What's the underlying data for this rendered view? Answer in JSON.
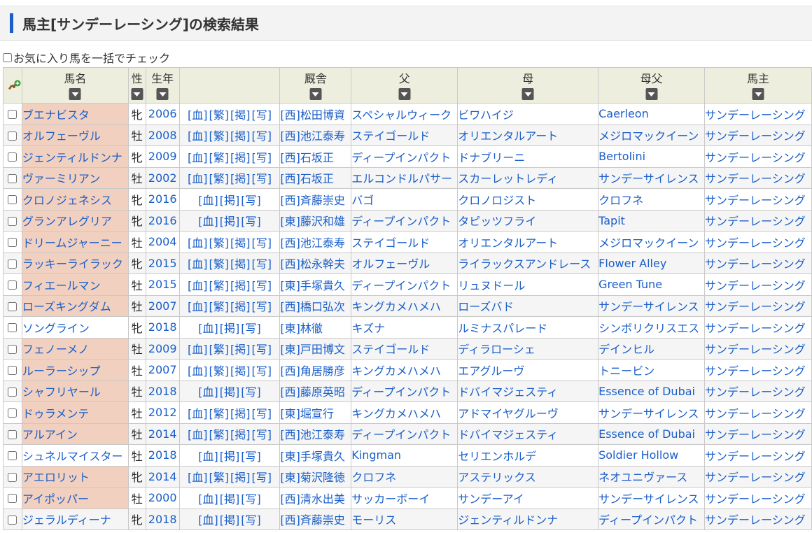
{
  "page": {
    "title": "馬主[サンデーレーシング]の検索結果"
  },
  "fav_check_all": {
    "label": "お気に入り馬を一括でチェック"
  },
  "table": {
    "headers": {
      "name": "馬名",
      "sex": "性",
      "year": "生年",
      "links": "",
      "trainer": "厩舎",
      "sire": "父",
      "dam": "母",
      "damsire": "母父",
      "owner": "馬主"
    },
    "rows": [
      {
        "name": "ブエナビスタ",
        "hl": true,
        "sex": "牝",
        "year": "2006",
        "links": [
          "[血]",
          "[繁]",
          "[掲]",
          "[写]"
        ],
        "trainer": "[西]松田博資",
        "sire": "スペシャルウィーク",
        "dam": "ビワハイジ",
        "damsire": "Caerleon",
        "owner": "サンデーレーシング"
      },
      {
        "name": "オルフェーヴル",
        "hl": true,
        "sex": "牡",
        "year": "2008",
        "links": [
          "[血]",
          "[繁]",
          "[掲]",
          "[写]"
        ],
        "trainer": "[西]池江泰寿",
        "sire": "ステイゴールド",
        "dam": "オリエンタルアート",
        "damsire": "メジロマックイーン",
        "owner": "サンデーレーシング"
      },
      {
        "name": "ジェンティルドンナ",
        "hl": true,
        "sex": "牝",
        "year": "2009",
        "links": [
          "[血]",
          "[繁]",
          "[掲]",
          "[写]"
        ],
        "trainer": "[西]石坂正",
        "sire": "ディープインパクト",
        "dam": "ドナブリーニ",
        "damsire": "Bertolini",
        "owner": "サンデーレーシング"
      },
      {
        "name": "ヴァーミリアン",
        "hl": true,
        "sex": "牡",
        "year": "2002",
        "links": [
          "[血]",
          "[繁]",
          "[掲]",
          "[写]"
        ],
        "trainer": "[西]石坂正",
        "sire": "エルコンドルパサー",
        "dam": "スカーレットレディ",
        "damsire": "サンデーサイレンス",
        "owner": "サンデーレーシング"
      },
      {
        "name": "クロノジェネシス",
        "hl": true,
        "sex": "牝",
        "year": "2016",
        "links": [
          "[血]",
          "[掲]",
          "[写]"
        ],
        "trainer": "[西]斉藤崇史",
        "sire": "バゴ",
        "dam": "クロノロジスト",
        "damsire": "クロフネ",
        "owner": "サンデーレーシング"
      },
      {
        "name": "グランアレグリア",
        "hl": true,
        "sex": "牝",
        "year": "2016",
        "links": [
          "[血]",
          "[掲]",
          "[写]"
        ],
        "trainer": "[東]藤沢和雄",
        "sire": "ディープインパクト",
        "dam": "タピッツフライ",
        "damsire": "Tapit",
        "owner": "サンデーレーシング"
      },
      {
        "name": "ドリームジャーニー",
        "hl": true,
        "sex": "牡",
        "year": "2004",
        "links": [
          "[血]",
          "[繁]",
          "[掲]",
          "[写]"
        ],
        "trainer": "[西]池江泰寿",
        "sire": "ステイゴールド",
        "dam": "オリエンタルアート",
        "damsire": "メジロマックイーン",
        "owner": "サンデーレーシング"
      },
      {
        "name": "ラッキーライラック",
        "hl": true,
        "sex": "牝",
        "year": "2015",
        "links": [
          "[血]",
          "[繁]",
          "[掲]",
          "[写]"
        ],
        "trainer": "[西]松永幹夫",
        "sire": "オルフェーヴル",
        "dam": "ライラックスアンドレース",
        "damsire": "Flower Alley",
        "owner": "サンデーレーシング"
      },
      {
        "name": "フィエールマン",
        "hl": true,
        "sex": "牡",
        "year": "2015",
        "links": [
          "[血]",
          "[繁]",
          "[掲]",
          "[写]"
        ],
        "trainer": "[東]手塚貴久",
        "sire": "ディープインパクト",
        "dam": "リュヌドール",
        "damsire": "Green Tune",
        "owner": "サンデーレーシング"
      },
      {
        "name": "ローズキングダム",
        "hl": true,
        "sex": "牡",
        "year": "2007",
        "links": [
          "[血]",
          "[繁]",
          "[掲]",
          "[写]"
        ],
        "trainer": "[西]橋口弘次",
        "sire": "キングカメハメハ",
        "dam": "ローズバド",
        "damsire": "サンデーサイレンス",
        "owner": "サンデーレーシング"
      },
      {
        "name": "ソングライン",
        "hl": false,
        "sex": "牝",
        "year": "2018",
        "links": [
          "[血]",
          "[掲]",
          "[写]"
        ],
        "trainer": "[東]林徹",
        "sire": "キズナ",
        "dam": "ルミナスパレード",
        "damsire": "シンボリクリスエス",
        "owner": "サンデーレーシング"
      },
      {
        "name": "フェノーメノ",
        "hl": true,
        "sex": "牡",
        "year": "2009",
        "links": [
          "[血]",
          "[繁]",
          "[掲]",
          "[写]"
        ],
        "trainer": "[東]戸田博文",
        "sire": "ステイゴールド",
        "dam": "ディラローシェ",
        "damsire": "デインヒル",
        "owner": "サンデーレーシング"
      },
      {
        "name": "ルーラーシップ",
        "hl": true,
        "sex": "牡",
        "year": "2007",
        "links": [
          "[血]",
          "[繁]",
          "[掲]",
          "[写]"
        ],
        "trainer": "[西]角居勝彦",
        "sire": "キングカメハメハ",
        "dam": "エアグルーヴ",
        "damsire": "トニービン",
        "owner": "サンデーレーシング"
      },
      {
        "name": "シャフリヤール",
        "hl": true,
        "sex": "牡",
        "year": "2018",
        "links": [
          "[血]",
          "[掲]",
          "[写]"
        ],
        "trainer": "[西]藤原英昭",
        "sire": "ディープインパクト",
        "dam": "ドバイマジェスティ",
        "damsire": "Essence of Dubai",
        "owner": "サンデーレーシング"
      },
      {
        "name": "ドゥラメンテ",
        "hl": true,
        "sex": "牡",
        "year": "2012",
        "links": [
          "[血]",
          "[繁]",
          "[掲]",
          "[写]"
        ],
        "trainer": "[東]堀宣行",
        "sire": "キングカメハメハ",
        "dam": "アドマイヤグルーヴ",
        "damsire": "サンデーサイレンス",
        "owner": "サンデーレーシング"
      },
      {
        "name": "アルアイン",
        "hl": true,
        "sex": "牡",
        "year": "2014",
        "links": [
          "[血]",
          "[繁]",
          "[掲]",
          "[写]"
        ],
        "trainer": "[西]池江泰寿",
        "sire": "ディープインパクト",
        "dam": "ドバイマジェスティ",
        "damsire": "Essence of Dubai",
        "owner": "サンデーレーシング"
      },
      {
        "name": "シュネルマイスター",
        "hl": false,
        "sex": "牡",
        "year": "2018",
        "links": [
          "[血]",
          "[掲]",
          "[写]"
        ],
        "trainer": "[東]手塚貴久",
        "sire": "Kingman",
        "dam": "セリエンホルデ",
        "damsire": "Soldier Hollow",
        "owner": "サンデーレーシング"
      },
      {
        "name": "アエロリット",
        "hl": true,
        "sex": "牝",
        "year": "2014",
        "links": [
          "[血]",
          "[繁]",
          "[掲]",
          "[写]"
        ],
        "trainer": "[東]菊沢隆徳",
        "sire": "クロフネ",
        "dam": "アステリックス",
        "damsire": "ネオユニヴァース",
        "owner": "サンデーレーシング"
      },
      {
        "name": "アイポッパー",
        "hl": true,
        "sex": "牡",
        "year": "2000",
        "links": [
          "[血]",
          "[掲]",
          "[写]"
        ],
        "trainer": "[西]清水出美",
        "sire": "サッカーボーイ",
        "dam": "サンデーアイ",
        "damsire": "サンデーサイレンス",
        "owner": "サンデーレーシング"
      },
      {
        "name": "ジェラルディーナ",
        "hl": false,
        "sex": "牝",
        "year": "2018",
        "links": [
          "[血]",
          "[掲]",
          "[写]"
        ],
        "trainer": "[西]斉藤崇史",
        "sire": "モーリス",
        "dam": "ジェンティルドンナ",
        "damsire": "ディープインパクト",
        "owner": "サンデーレーシング"
      }
    ]
  }
}
